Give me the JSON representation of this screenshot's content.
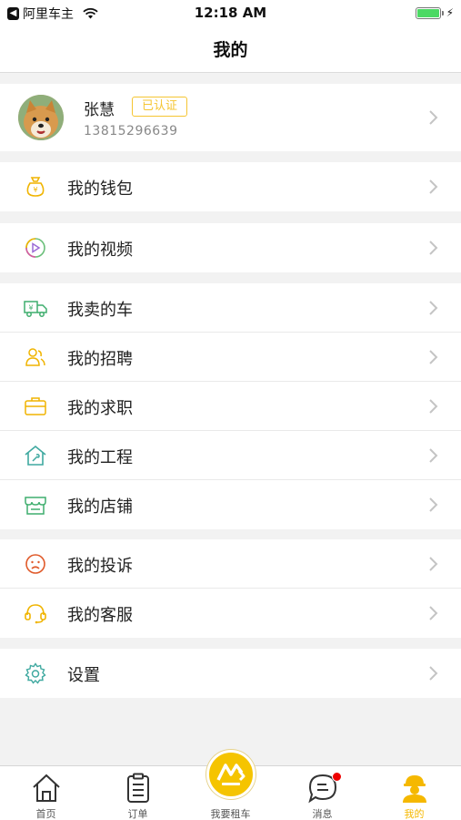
{
  "status_bar": {
    "carrier": "阿里车主",
    "time": "12:18 AM"
  },
  "nav": {
    "title": "我的"
  },
  "profile": {
    "name": "张慧",
    "badge": "已认证",
    "phone": "13815296639"
  },
  "menu_groups": [
    {
      "items": [
        {
          "label": "我的钱包",
          "icon": "wallet-icon"
        }
      ]
    },
    {
      "items": [
        {
          "label": "我的视频",
          "icon": "video-icon"
        }
      ]
    },
    {
      "items": [
        {
          "label": "我卖的车",
          "icon": "truck-icon"
        },
        {
          "label": "我的招聘",
          "icon": "recruit-icon"
        },
        {
          "label": "我的求职",
          "icon": "briefcase-icon"
        },
        {
          "label": "我的工程",
          "icon": "house-wrench-icon"
        },
        {
          "label": "我的店铺",
          "icon": "store-icon"
        }
      ]
    },
    {
      "items": [
        {
          "label": "我的投诉",
          "icon": "sad-face-icon"
        },
        {
          "label": "我的客服",
          "icon": "headset-icon"
        }
      ]
    },
    {
      "items": [
        {
          "label": "设置",
          "icon": "gear-icon"
        }
      ]
    }
  ],
  "tab_bar": {
    "tabs": [
      {
        "label": "首页",
        "icon": "home-icon"
      },
      {
        "label": "订单",
        "icon": "clipboard-icon"
      },
      {
        "label": "我要租车",
        "icon": "excavator-logo-icon"
      },
      {
        "label": "消息",
        "icon": "chat-icon"
      },
      {
        "label": "我的",
        "icon": "worker-icon"
      }
    ],
    "active_index": 4
  },
  "colors": {
    "accent": "#f5c400",
    "active_tab": "#f5b800",
    "badge": "#f5c532",
    "notification": "#ee0000"
  }
}
